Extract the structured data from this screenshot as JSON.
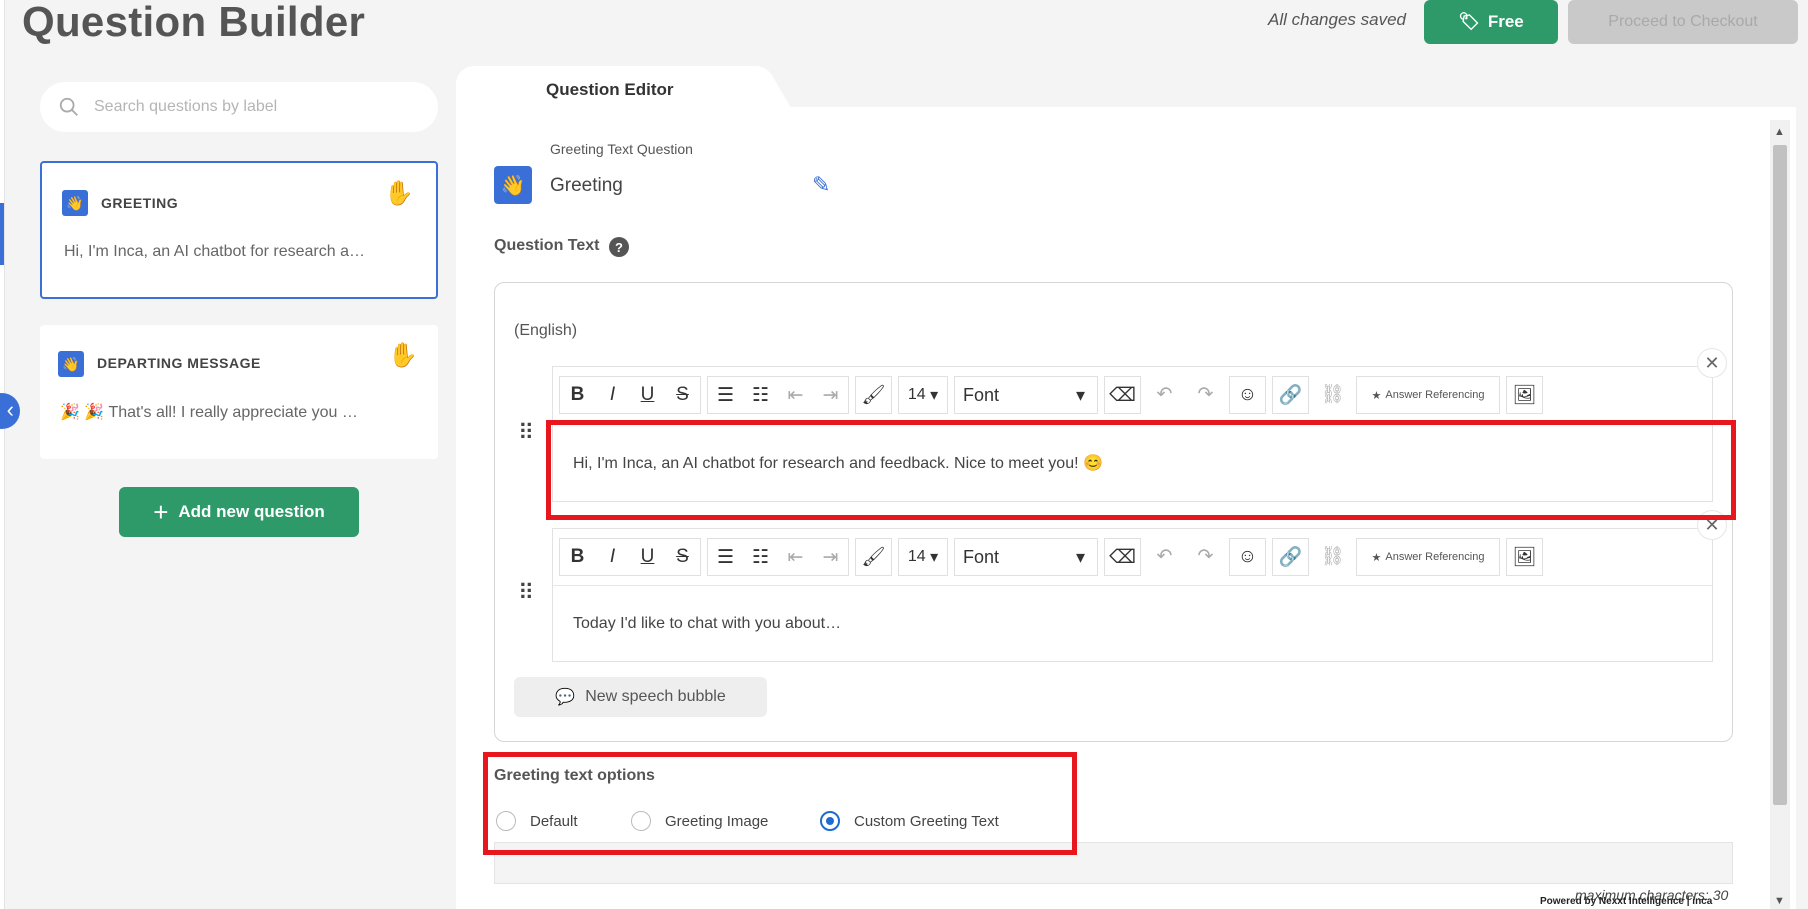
{
  "page_title": "Question Builder",
  "header": {
    "saved_status": "All changes saved",
    "free_label": "Free",
    "checkout_label": "Proceed to Checkout"
  },
  "sidebar": {
    "search_placeholder": "Search questions by label",
    "cards": [
      {
        "label": "GREETING",
        "text": "Hi, I'm Inca, an AI chatbot for research a…",
        "icon": "wave-icon"
      },
      {
        "label": "DEPARTING MESSAGE",
        "text": "🎉 🎉 That's all! I really appreciate you …",
        "icon": "wave-icon"
      }
    ],
    "add_question_label": "Add new question"
  },
  "editor": {
    "tab_label": "Question Editor",
    "question_type": "Greeting Text Question",
    "question_name": "Greeting",
    "question_text_label": "Question Text",
    "help_glyph": "?",
    "language": "(English)",
    "toolbar": {
      "font_size": "14",
      "font_label": "Font",
      "answer_referencing": "Answer Referencing"
    },
    "bubbles": [
      {
        "text": "Hi, I'm Inca, an AI chatbot for research and feedback. Nice to meet you! 😊"
      },
      {
        "text": "Today I'd like to chat with you  about…"
      }
    ],
    "new_bubble_label": "New speech bubble",
    "greeting_options": {
      "label": "Greeting text options",
      "options": [
        "Default",
        "Greeting Image",
        "Custom Greeting Text"
      ],
      "selected": "Custom Greeting Text"
    },
    "max_chars": "maximum characters: 30",
    "powered_by": "Powered by Nexxt Intelligence | inca"
  },
  "colors": {
    "accent_blue": "#3b6fd8",
    "green": "#2e9a6a",
    "highlight_red": "#e8161d"
  }
}
